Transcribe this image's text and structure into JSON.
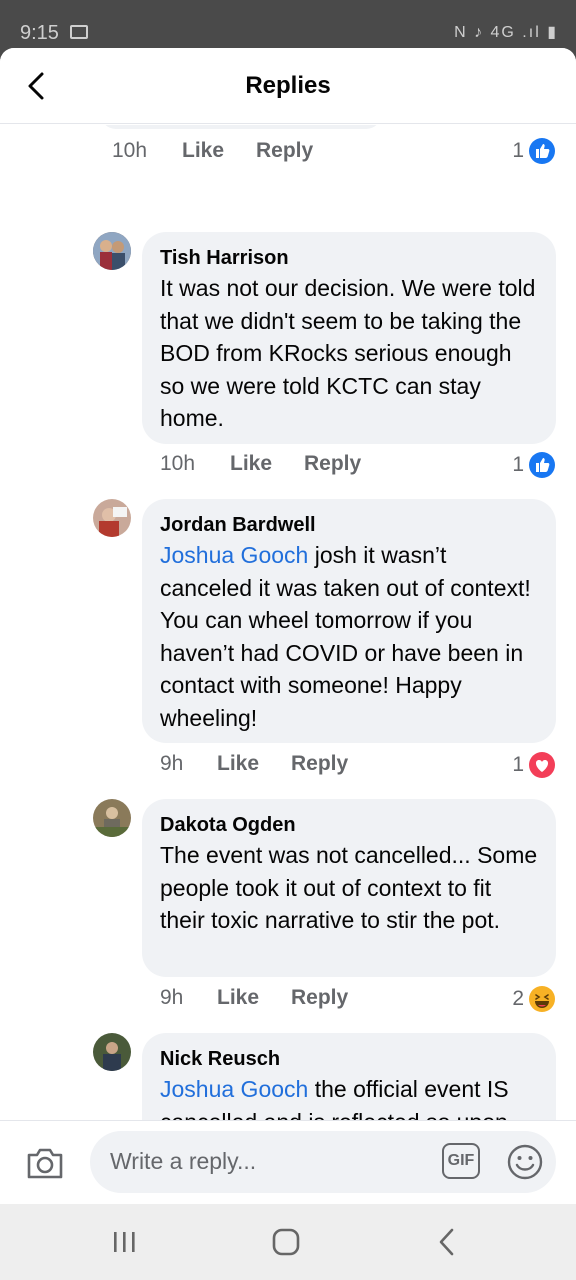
{
  "status_bar": {
    "time": "9:15",
    "right_icons": "N ♪ 4G .ıl ▮"
  },
  "header": {
    "title": "Replies"
  },
  "prev_comment": {
    "time": "10h",
    "like_label": "Like",
    "reply_label": "Reply",
    "reaction_count": "1",
    "reaction": "like"
  },
  "comments": [
    {
      "author": "Tish Harrison",
      "mention": "",
      "text": "It was not our decision. We were told that we didn't seem to be taking the BOD from KRocks serious enough so we were told KCTC can stay home.",
      "time": "10h",
      "like_label": "Like",
      "reply_label": "Reply",
      "reaction_count": "1",
      "reaction": "like"
    },
    {
      "author": "Jordan Bardwell",
      "mention": "Joshua Gooch",
      "text": " josh it wasn’t canceled it was taken out of context! You can wheel tomorrow if you haven’t had COVID or have been in contact with someone! Happy wheeling!",
      "time": "9h",
      "like_label": "Like",
      "reply_label": "Reply",
      "reaction_count": "1",
      "reaction": "love"
    },
    {
      "author": "Dakota Ogden",
      "mention": "",
      "text": "The event was not cancelled... Some people took it out of context to fit their toxic narrative to stir the pot.",
      "time": "9h",
      "like_label": "Like",
      "reply_label": "Reply",
      "reaction_count": "2",
      "reaction": "haha"
    },
    {
      "author": "Nick Reusch",
      "mention": "Joshua Gooch",
      "text": " the official event IS cancelled and is reflected so upon the events page."
    }
  ],
  "composer": {
    "placeholder": "Write a reply...",
    "gif_label": "GIF"
  },
  "colors": {
    "link": "#216fdb",
    "like": "#1877f2",
    "love": "#f33e58",
    "haha": "#f7b125"
  }
}
